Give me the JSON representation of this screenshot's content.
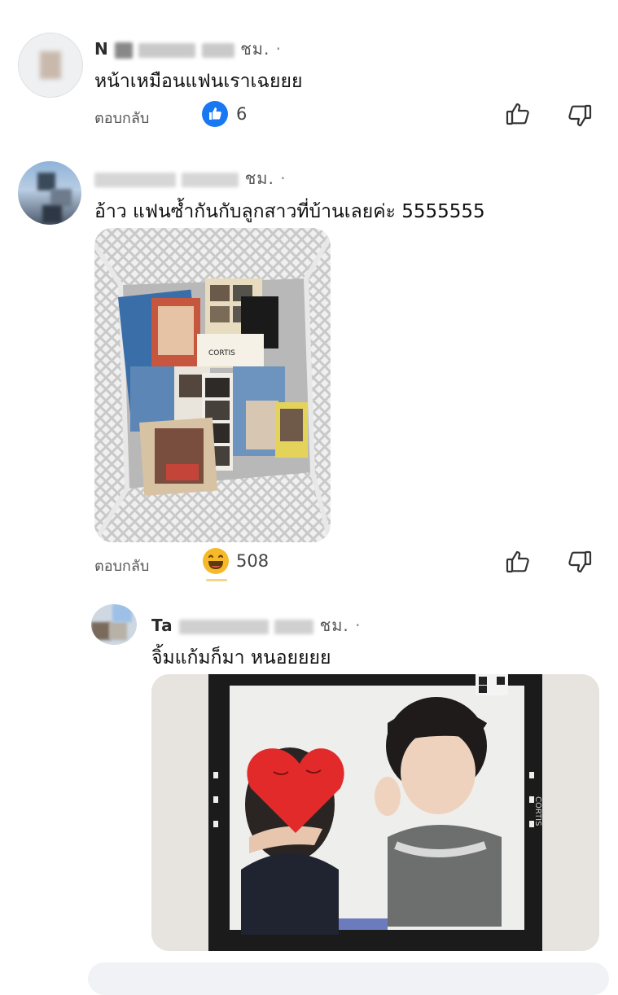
{
  "comments": [
    {
      "name": "N",
      "meta": "ชม.",
      "text": "หน้าเหมือนแฟนเราเฉยยย",
      "reply_label": "ตอบกลับ",
      "reaction": "like-icon",
      "reaction_count": "6"
    },
    {
      "name": "",
      "meta": "ชม.",
      "text": "อ้าว แฟนซ้ำกันกับลูกสาวที่บ้านเลยค่ะ 5555555",
      "reply_label": "ตอบกลับ",
      "reaction": "haha-icon",
      "reaction_count": "508",
      "photo": {
        "card_labels": [
          "CORTIS",
          "CORTIS"
        ]
      }
    }
  ],
  "reply": {
    "name": "Ta",
    "meta": "ชม.",
    "text": "จิ้มแก้มก็มา หนอยยยย",
    "photo": {
      "side_label": "CORTIS"
    }
  },
  "colors": {
    "like_blue": "#1877f2",
    "haha_yellow": "#f7b928"
  }
}
